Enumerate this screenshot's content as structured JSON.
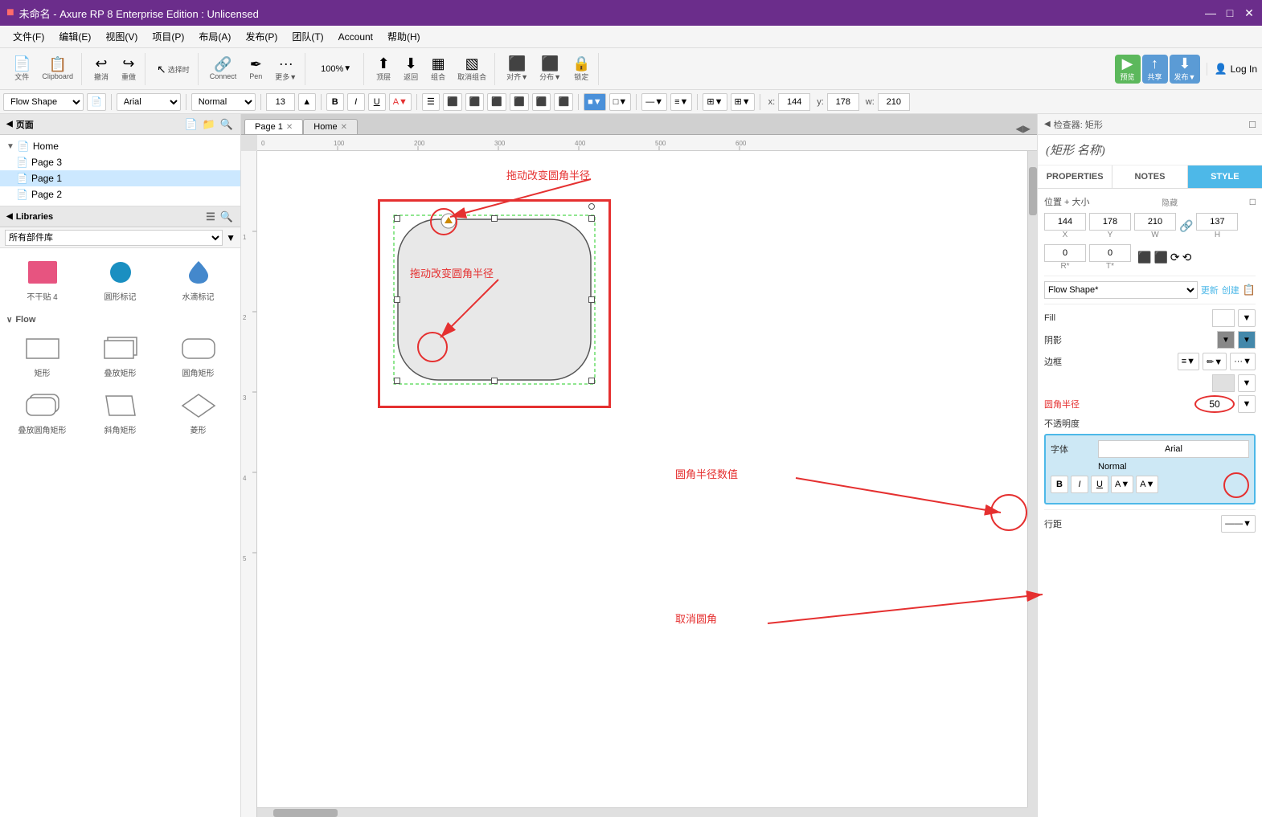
{
  "window": {
    "title": "未命名 - Axure RP 8 Enterprise Edition : Unlicensed",
    "logo": "■"
  },
  "titlebar": {
    "minimize": "—",
    "maximize": "□",
    "close": "✕"
  },
  "menu": {
    "items": [
      "文件(F)",
      "编辑(E)",
      "视图(V)",
      "项目(P)",
      "布局(A)",
      "发布(P)",
      "团队(T)",
      "Account",
      "帮助(H)"
    ]
  },
  "toolbar": {
    "undo": "撤消",
    "redo": "重做",
    "select": "选择时",
    "connect": "Connect",
    "pen": "Pen",
    "more": "更多▼",
    "zoom": "100%",
    "top": "顶层",
    "back": "返回",
    "group": "组合",
    "ungroup": "取消组合",
    "align": "对齐▼",
    "distribute": "分布▼",
    "lock": "锁定",
    "preview": "预览",
    "share": "共享",
    "publish": "发布▼",
    "login": "Log In"
  },
  "propsbar": {
    "widget_type": "Flow Shape",
    "font": "Arial",
    "style": "Normal",
    "size": "13",
    "bold": "B",
    "italic": "I",
    "underline": "U",
    "x_label": "x:",
    "x_val": "144",
    "y_label": "y:",
    "y_val": "178",
    "w_label": "w:",
    "w_val": "210"
  },
  "pages": {
    "title": "页面",
    "items": [
      {
        "label": "Home",
        "level": 0,
        "expanded": true
      },
      {
        "label": "Page 3",
        "level": 1,
        "active": false
      },
      {
        "label": "Page 1",
        "level": 1,
        "active": true
      },
      {
        "label": "Page 2",
        "level": 1,
        "active": false
      }
    ]
  },
  "libraries": {
    "title": "Libraries",
    "dropdown": "所有部件库",
    "section_flow": "Flow",
    "shapes": [
      {
        "label": "矩形",
        "type": "rect"
      },
      {
        "label": "叠放矩形",
        "type": "stack-rect"
      },
      {
        "label": "圆角矩形",
        "type": "round-rect"
      },
      {
        "label": "叠放圆角矩形",
        "type": "stack-round-rect"
      },
      {
        "label": "斜角矩形",
        "type": "skew-rect"
      },
      {
        "label": "菱形",
        "type": "diamond"
      }
    ],
    "library_items": [
      {
        "label": "不干贴 4",
        "type": "sticky"
      },
      {
        "label": "圆形标记",
        "type": "circle"
      },
      {
        "label": "水滴标记",
        "type": "drop"
      }
    ]
  },
  "canvas": {
    "tab1": "Page 1",
    "tab2": "Home"
  },
  "inspector": {
    "header": "检查器: 矩形",
    "title": "(矩形 名称)",
    "tabs": [
      "PROPERTIES",
      "NOTES",
      "STYLE"
    ],
    "active_tab": 2,
    "section_position": "位置 + 大小",
    "hide_label": "隐藏",
    "x": "144",
    "y": "178",
    "w": "210",
    "h": "137",
    "x_label": "X",
    "y_label": "Y",
    "w_label": "W",
    "h_label": "H",
    "r_label": "R*",
    "r_val": "0",
    "t_label": "T*",
    "t_val": "0",
    "shape_type": "Flow Shape*",
    "update_label": "更新",
    "create_label": "创建",
    "fill_label": "Fill",
    "shadow_label": "阴影",
    "border_label": "边框",
    "corner_radius_label": "圆角半径",
    "corner_radius_val": "50",
    "opacity_label": "不透明度",
    "font_label": "字体",
    "font_val": "Arial",
    "style_label": "Normal",
    "annotation_drag": "拖动改变圆角半径",
    "annotation_radius": "圆角半径数值",
    "annotation_cancel": "取消圆角"
  },
  "annotations": {
    "drag_label": "拖动改变圆角半径",
    "radius_label": "圆角半径数值",
    "cancel_label": "取消圆角"
  }
}
